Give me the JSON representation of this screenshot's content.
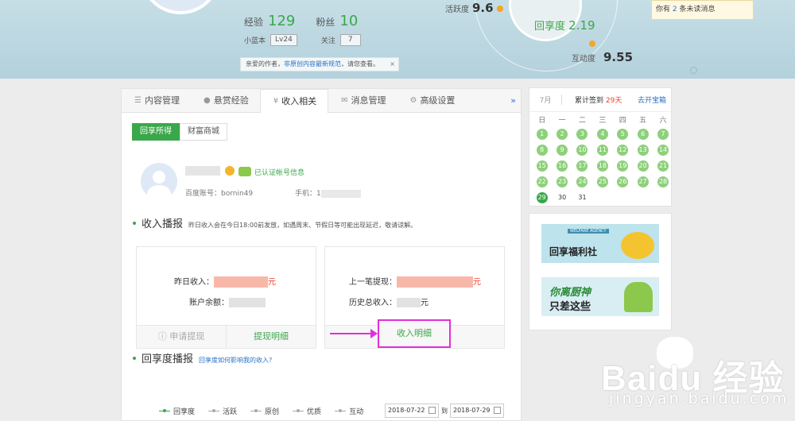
{
  "header": {
    "exp_label": "经验",
    "exp_value": "129",
    "fans_label": "粉丝",
    "fans_value": "10",
    "level_label": "小蓝本",
    "level_value": "Lv24",
    "follow_label": "关注",
    "follow_value": "7",
    "notice_prefix": "亲爱的作者，",
    "notice_link": "非原创内容最新规范",
    "notice_suffix": "，请您查看。",
    "notice_close": "×",
    "activity_label": "活跃度",
    "activity_value": "9.6",
    "share_label": "回享度",
    "share_value": "2.19",
    "interact_label": "互动度",
    "interact_value": "9.55",
    "msg_prefix": "你有",
    "msg_count": "2",
    "msg_suffix": "条未读消息"
  },
  "tabs": [
    {
      "label": "内容管理",
      "icon": "list-icon"
    },
    {
      "label": "悬赏经验",
      "icon": "coin-icon"
    },
    {
      "label": "收入相关",
      "icon": "yen-icon"
    },
    {
      "label": "消息管理",
      "icon": "mail-icon"
    },
    {
      "label": "高级设置",
      "icon": "gear-icon"
    }
  ],
  "tabs_more": "»",
  "subtabs": {
    "share_income": "回享所得",
    "wealth_mall": "财富商城"
  },
  "user": {
    "verified": "已认证帐号信息",
    "account_label": "百度账号：bornin49",
    "phone_label": "手机：1"
  },
  "income_section": {
    "title": "收入播报",
    "desc": "昨日收入会在今日18:00前发放，如遇周末、节假日等可能出现延迟，敬请谅解。"
  },
  "left_card": {
    "yesterday_label": "昨日收入：",
    "unit": "元",
    "balance_label": "账户余额：",
    "apply_btn": "申请提现",
    "apply_icon": "info-icon",
    "detail_btn": "提现明细"
  },
  "right_card": {
    "last_label": "上一笔提现：",
    "unit": "元",
    "total_label": "历史总收入：",
    "total_unit": "元",
    "income_detail_btn": "收入明细"
  },
  "share_section": {
    "title": "回享度播报",
    "link": "回享度如何影响我的收入?"
  },
  "legend": [
    "回享度",
    "活跃",
    "原创",
    "优质",
    "互动"
  ],
  "dates": {
    "from": "2018-07-22",
    "to_label": "到",
    "to": "2018-07-29"
  },
  "calendar": {
    "month": "7月",
    "checkin_prefix": "累计签到",
    "checkin_days": "29天",
    "treasure": "去开宝箱",
    "weekdays": [
      "日",
      "一",
      "二",
      "三",
      "四",
      "五",
      "六"
    ],
    "days": [
      "1",
      "2",
      "3",
      "4",
      "5",
      "6",
      "7",
      "8",
      "9",
      "10",
      "11",
      "12",
      "13",
      "14",
      "15",
      "16",
      "17",
      "18",
      "19",
      "20",
      "21",
      "22",
      "23",
      "24",
      "25",
      "26",
      "27",
      "28",
      "29",
      "30",
      "31"
    ],
    "signed_through": 29
  },
  "banners": {
    "welfare": "回享福利社",
    "welfare_tag": "WELFARE AGENCY",
    "chef1": "你离厨神",
    "chef2": "只差这些"
  },
  "watermark": {
    "brand": "Baidu 经验",
    "url": "jingyan.baidu.com"
  },
  "colors": {
    "accent": "#3aa84a",
    "link": "#2a72c8",
    "highlight": "#e030d8",
    "warn": "#e6442b"
  }
}
